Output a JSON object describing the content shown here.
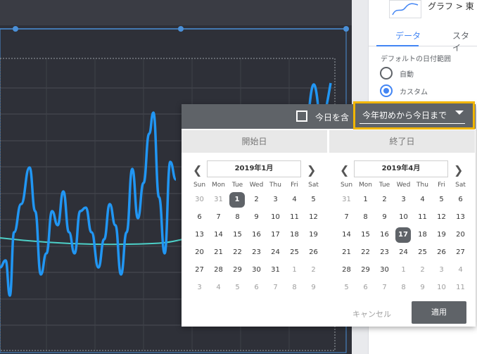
{
  "panel": {
    "chart_type": "グラフ > 東",
    "tabs": [
      "データ",
      "スタイ"
    ],
    "section_title": "デフォルトの日付範囲",
    "options": [
      "自動",
      "カスタム"
    ],
    "selected_option": "カスタム"
  },
  "picker": {
    "today_label": "今日を含",
    "preset": "今年初めから今日まで",
    "start_label": "開始日",
    "end_label": "終了日",
    "weekdays": [
      "Sun",
      "Mon",
      "Tue",
      "Wed",
      "Thu",
      "Fri",
      "Sat"
    ],
    "start_month": "2019年1月",
    "end_month": "2019年4月",
    "start_days": [
      [
        "30",
        "31",
        "1",
        "2",
        "3",
        "4",
        "5"
      ],
      [
        "6",
        "7",
        "8",
        "9",
        "10",
        "11",
        "12"
      ],
      [
        "13",
        "14",
        "15",
        "16",
        "17",
        "18",
        "19"
      ],
      [
        "20",
        "21",
        "22",
        "23",
        "24",
        "25",
        "26"
      ],
      [
        "27",
        "28",
        "29",
        "30",
        "31",
        "1",
        "2"
      ],
      [
        "3",
        "4",
        "5",
        "6",
        "7",
        "8",
        "9"
      ]
    ],
    "end_days": [
      [
        "31",
        "1",
        "2",
        "3",
        "4",
        "5",
        "6"
      ],
      [
        "7",
        "8",
        "9",
        "10",
        "11",
        "12",
        "13"
      ],
      [
        "14",
        "15",
        "16",
        "17",
        "18",
        "19",
        "20"
      ],
      [
        "21",
        "22",
        "23",
        "24",
        "25",
        "26",
        "27"
      ],
      [
        "28",
        "29",
        "30",
        "1",
        "2",
        "3",
        "4"
      ],
      [
        "5",
        "6",
        "7",
        "8",
        "9",
        "10",
        "11"
      ]
    ],
    "start_selected": "1",
    "end_selected": "17",
    "cancel_label": "キャンセル",
    "apply_label": "適用"
  },
  "colors": {
    "accent": "#4285f4",
    "highlight": "#f2b600",
    "series": "#2196f3",
    "trend": "#4dd0c8"
  }
}
